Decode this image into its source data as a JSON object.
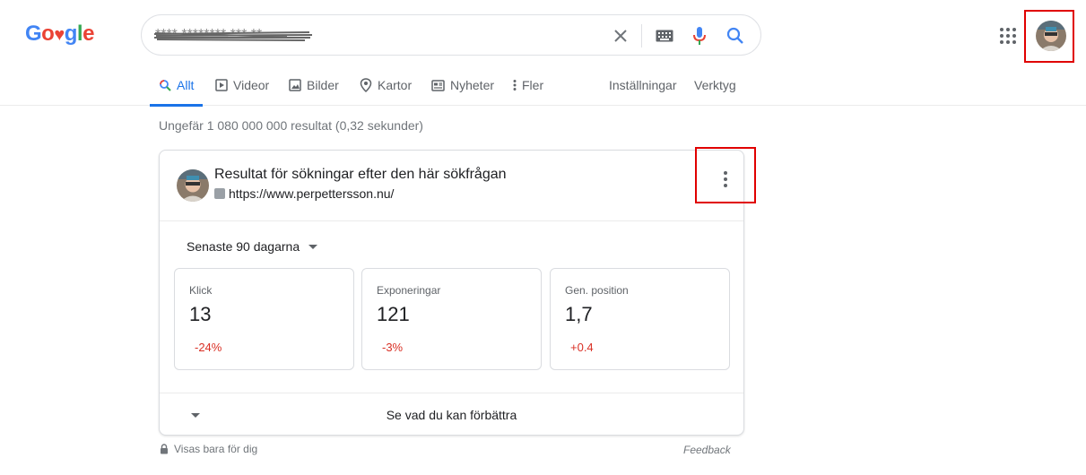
{
  "logo": {
    "letters": [
      "G",
      "o",
      "♥",
      "g",
      "l",
      "e"
    ]
  },
  "search": {
    "query": "**** ******** *** **"
  },
  "tabs": [
    {
      "label": "Allt",
      "icon": "search-icon"
    },
    {
      "label": "Videor",
      "icon": "play-icon"
    },
    {
      "label": "Bilder",
      "icon": "image-icon"
    },
    {
      "label": "Kartor",
      "icon": "map-pin-icon"
    },
    {
      "label": "Nyheter",
      "icon": "news-icon"
    },
    {
      "label": "Fler",
      "icon": "more-vert-icon"
    }
  ],
  "tools": {
    "settings": "Inställningar",
    "tools": "Verktyg"
  },
  "result_stats": "Ungefär 1 080 000 000 resultat (0,32 sekunder)",
  "card": {
    "title": "Resultat för sökningar efter den här sökfrågan",
    "url": "https://www.perpettersson.nu/",
    "range": "Senaste 90 dagarna",
    "metrics": [
      {
        "label": "Klick",
        "value": "13",
        "delta": "-24%"
      },
      {
        "label": "Exponeringar",
        "value": "121",
        "delta": "-3%"
      },
      {
        "label": "Gen. position",
        "value": "1,7",
        "delta": "+0.4"
      }
    ],
    "footer": "Se vad du kan förbättra"
  },
  "private_note": "Visas bara för dig",
  "feedback": "Feedback",
  "colors": {
    "accent": "#1a73e8",
    "negative": "#d93025",
    "highlight": "#e00000"
  }
}
